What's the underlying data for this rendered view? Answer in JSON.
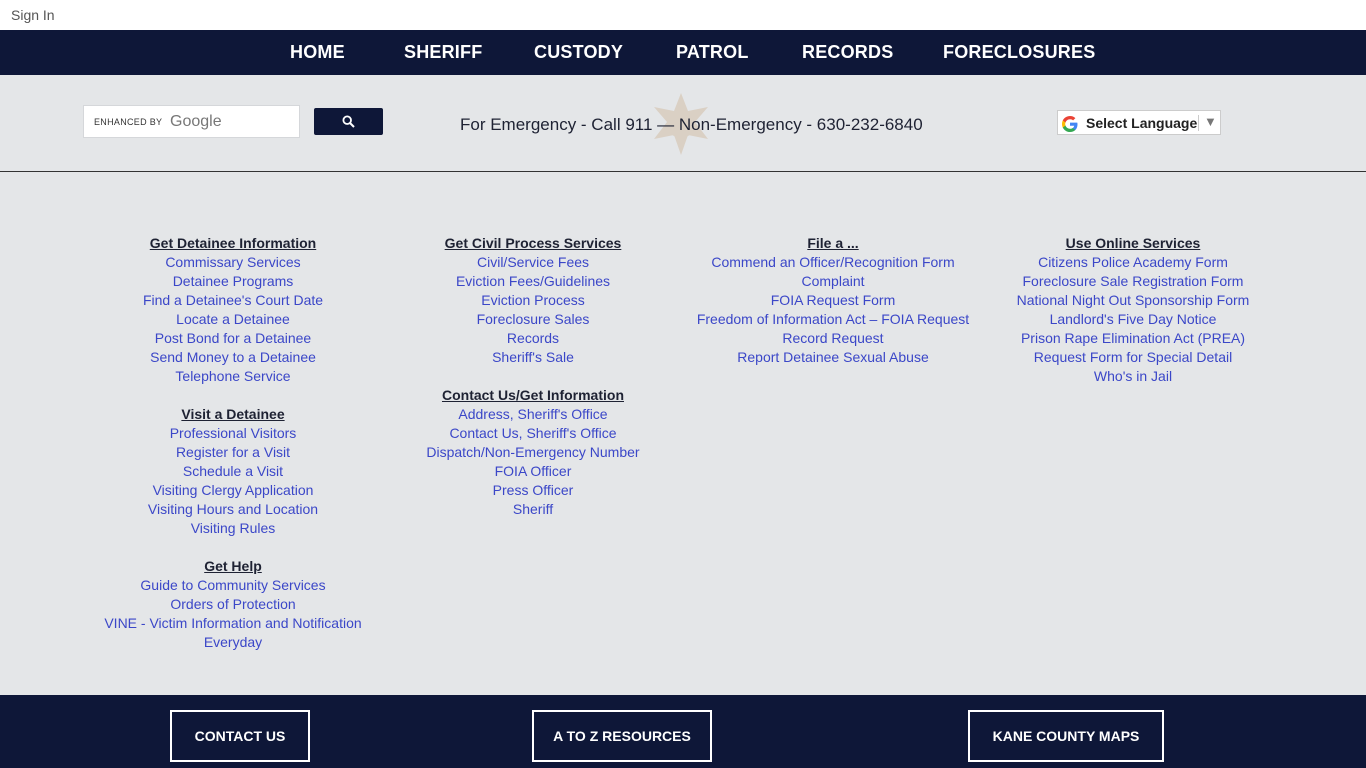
{
  "topbar": {
    "sign_in": "Sign In"
  },
  "nav": {
    "items": [
      {
        "label": "HOME"
      },
      {
        "label": "SHERIFF"
      },
      {
        "label": "CUSTODY"
      },
      {
        "label": "PATROL"
      },
      {
        "label": "RECORDS"
      },
      {
        "label": "FORECLOSURES"
      }
    ]
  },
  "search": {
    "enhanced_label": "ENHANCED BY",
    "google_label": "Google"
  },
  "emergency": "For Emergency - Call 911 — Non-Emergency - 630-232-6840",
  "language": {
    "select_label": "Select Language",
    "arrow": "▼"
  },
  "columns": [
    {
      "sections": [
        {
          "heading": "Get Detainee Information",
          "links": [
            "Commissary Services",
            "Detainee Programs",
            "Find a Detainee's Court Date",
            "Locate a Detainee",
            "Post Bond for a Detainee",
            "Send Money to a Detainee",
            "Telephone Service"
          ]
        },
        {
          "heading": "Visit a Detainee",
          "links": [
            "Professional Visitors",
            "Register for a Visit",
            "Schedule a Visit",
            "Visiting Clergy Application",
            "Visiting Hours and Location",
            "Visiting Rules"
          ]
        },
        {
          "heading": "Get Help ",
          "links": [
            "Guide to Community Services",
            "Orders of Protection",
            "VINE - Victim Information and Notification",
            "Everyday"
          ]
        }
      ]
    },
    {
      "sections": [
        {
          "heading": "Get Civil Process Services",
          "links": [
            "Civil/Service Fees",
            "Eviction Fees/Guidelines",
            "Eviction Process",
            "Foreclosure Sales",
            "Records",
            "Sheriff's Sale"
          ]
        },
        {
          "heading": "Contact Us/Get Information",
          "links": [
            "Address, Sheriff's Office",
            "Contact Us, Sheriff's Office",
            "Dispatch/Non-Emergency Number",
            "FOIA Officer",
            "Press Officer",
            "Sheriff"
          ]
        }
      ]
    },
    {
      "sections": [
        {
          "heading": "File a ... ",
          "links": [
            "Commend an Officer/Recognition Form",
            "Complaint",
            "FOIA Request Form  ",
            "Freedom of Information Act – FOIA Request",
            "Record Request",
            "Report Detainee Sexual Abuse"
          ]
        }
      ]
    },
    {
      "sections": [
        {
          "heading": "Use Online Services",
          "links": [
            "Citizens Police Academy Form",
            "Foreclosure Sale Registration Form",
            "National Night Out Sponsorship Form",
            "Landlord's Five Day Notice",
            "Prison Rape Elimination Act (PREA)",
            "Request Form for Special Detail",
            "Who's in Jail"
          ]
        }
      ]
    }
  ],
  "footer": {
    "buttons": [
      {
        "label": "CONTACT US"
      },
      {
        "label": "A TO Z RESOURCES"
      },
      {
        "label": "KANE COUNTY MAPS"
      }
    ]
  }
}
